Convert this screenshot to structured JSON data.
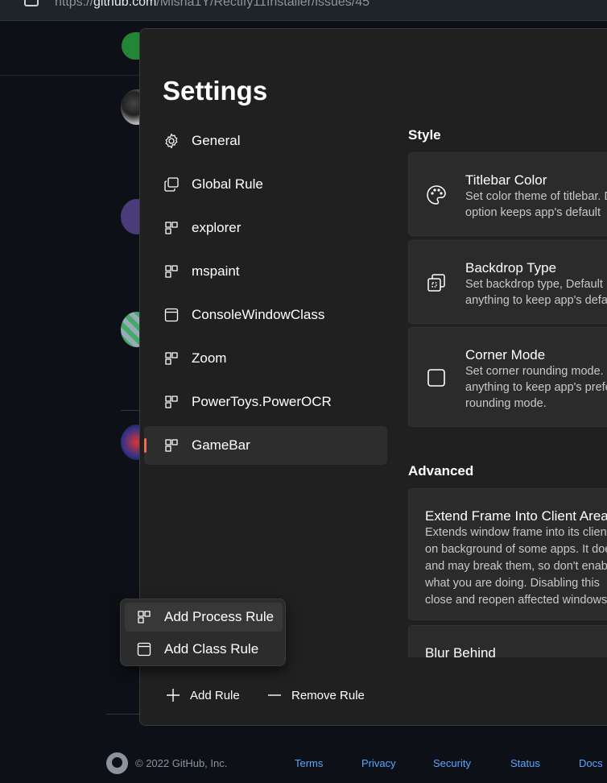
{
  "browser": {
    "url_prefix": "https://",
    "url_host": "github.com",
    "url_path": "/Misha1Y/Rectify11Installer/issues/45"
  },
  "settings": {
    "title": "Settings",
    "nav_items": [
      {
        "label": "General",
        "icon": "gear-icon"
      },
      {
        "label": "Global Rule",
        "icon": "copy-windows-icon"
      },
      {
        "label": "explorer",
        "icon": "process-rule-icon"
      },
      {
        "label": "mspaint",
        "icon": "process-rule-icon"
      },
      {
        "label": "ConsoleWindowClass",
        "icon": "class-rule-icon"
      },
      {
        "label": "Zoom",
        "icon": "process-rule-icon"
      },
      {
        "label": "PowerToys.PowerOCR",
        "icon": "process-rule-icon"
      },
      {
        "label": "GameBar",
        "icon": "process-rule-icon",
        "selected": true
      }
    ],
    "style_section": "Style",
    "cards": [
      {
        "title": "Titlebar Color",
        "desc1": "Set color theme of titlebar. Default",
        "desc2": "option keeps app's default",
        "icon": "palette-icon"
      },
      {
        "title": "Backdrop Type",
        "desc1": "Set backdrop type, Default",
        "desc2": "anything to keep app's default",
        "icon": "backdrop-icon"
      },
      {
        "title": "Corner Mode",
        "desc1": "Set corner rounding mode. Default",
        "desc2": "anything to keep app's preferred",
        "desc3": "rounding mode.",
        "icon": "square-icon"
      }
    ],
    "advanced_section": "Advanced",
    "advanced_card": {
      "title": "Extend Frame Into Client Area",
      "lines": [
        "Extends window frame into its client area",
        "on background of some apps. It does",
        "and may break them, so don't enable",
        "what you are doing. Disabling this",
        "close and reopen affected windows"
      ]
    },
    "blur_card": {
      "title": "Blur Behind"
    },
    "add_rule": "Add Rule",
    "remove_rule": "Remove Rule"
  },
  "flyout": {
    "items": [
      {
        "label": "Add Process Rule",
        "icon": "process-rule-icon"
      },
      {
        "label": "Add Class Rule",
        "icon": "class-rule-icon"
      }
    ]
  },
  "footer": {
    "copyright": "© 2022 GitHub, Inc.",
    "links": [
      "Terms",
      "Privacy",
      "Security",
      "Status",
      "Docs"
    ]
  },
  "colors": {
    "accent": "#f06a54",
    "link": "#58a6ff",
    "window_bg": "#202020",
    "card_bg": "#2b2b2b"
  }
}
